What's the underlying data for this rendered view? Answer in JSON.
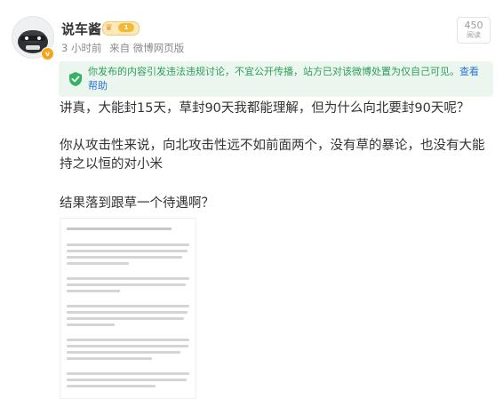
{
  "author": {
    "name": "说车酱",
    "vip_level": "1"
  },
  "post_meta": {
    "time": "3 小时前",
    "source": "来自 微博网页版"
  },
  "view_badge": {
    "count": "450",
    "label": "阅读"
  },
  "notice": {
    "text": "你发布的内容引发违法违规讨论，不宜公开传播，站方已对该微博处置为仅自己可见。",
    "link": "查看帮助"
  },
  "content": {
    "paragraph_1": "讲真，大能封15天，草封90天我都能理解，但为什么向北要封90天呢？",
    "paragraph_2": "你从攻击性来说，向北攻击性远不如前面两个，没有草的暴论，也没有大能持之以恒的对小米",
    "paragraph_3": "结果落到跟草一个待遇啊？"
  },
  "colors": {
    "notice_bg": "#eaf6ee",
    "notice_text": "#2f9e5a",
    "link": "#2f73d9",
    "vip": "#f1b93a"
  }
}
